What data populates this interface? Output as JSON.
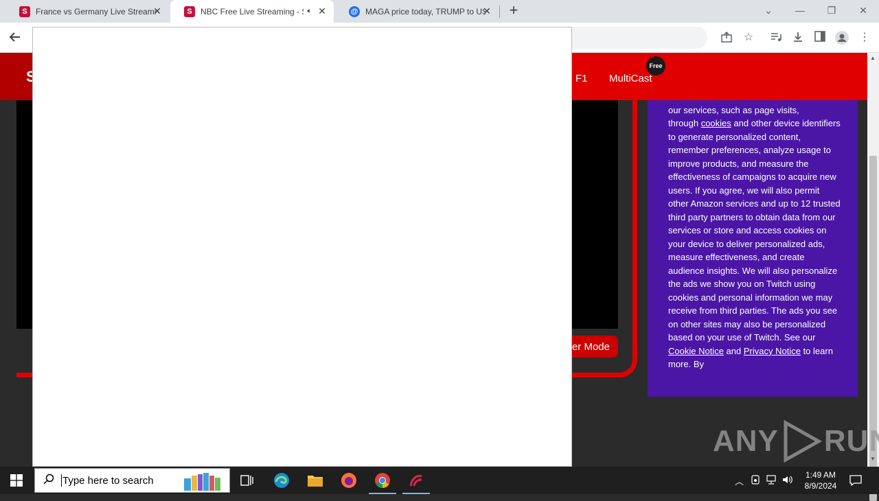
{
  "browser": {
    "tabs": [
      {
        "title": "France vs Germany Live Streamin",
        "favicon": "S",
        "favicon_color": "#c4123a",
        "active": false
      },
      {
        "title": "NBC Free Live Streaming - S",
        "favicon": "S",
        "favicon_color": "#c4123a",
        "active": true,
        "audio": "speaker-icon"
      },
      {
        "title": "MAGA price today, TRUMP to US",
        "favicon": "@",
        "favicon_color": "#1f6feb",
        "active": false
      }
    ]
  },
  "site": {
    "logo": "S",
    "nav": {
      "f1": "F1",
      "multicast": "MultiCast",
      "badge": "Free"
    },
    "mode_button": "er Mode",
    "accent": "#e00000"
  },
  "consent": {
    "line1": "our services, such as page visits,",
    "line2_pre": "through ",
    "line2_link": "cookies",
    "line2_post": " and other device",
    "body": "identifiers to generate personalized content, remember preferences, analyze usage to improve products, and measure the effectiveness of campaigns to acquire new users. If you agree, we will also permit other Amazon services and up to 12 trusted third party partners to obtain data from our services or store and access cookies on your device to deliver personalized ads, measure effectiveness, and create audience insights. We will also personalize the ads we show you on Twitch using cookies and personal information we may receive from third parties. The ads you see on other sites may also be personalized based on your use of Twitch. See our ",
    "cookie_notice": "Cookie Notice",
    "and": " and",
    "privacy_notice": "Privacy Notice",
    "tail": " to learn more. By",
    "bg": "#4b16a6"
  },
  "watermark": {
    "left": "ANY",
    "right": "RUN"
  },
  "taskbar": {
    "search_placeholder": "Type here to search",
    "time": "1:49 AM",
    "date": "8/9/2024"
  }
}
